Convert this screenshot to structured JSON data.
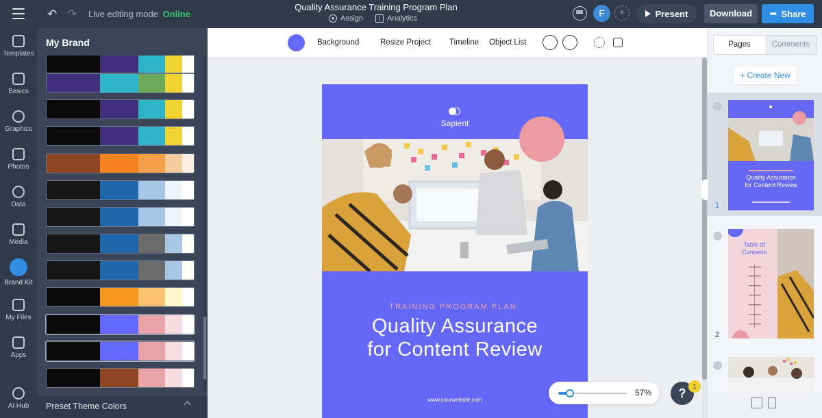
{
  "topbar": {
    "mode_label": "Live editing mode",
    "mode_status": "Online",
    "project_title": "Quality Assurance Training Program Plan",
    "assign_label": "Assign",
    "analytics_label": "Analytics",
    "avatar_letter": "F",
    "present_label": "Present",
    "download_label": "Download",
    "share_label": "Share"
  },
  "rail": {
    "items": [
      {
        "label": "Templates"
      },
      {
        "label": "Basics"
      },
      {
        "label": "Graphics"
      },
      {
        "label": "Photos"
      },
      {
        "label": "Data"
      },
      {
        "label": "Media"
      },
      {
        "label": "Brand Kit"
      },
      {
        "label": "My Files"
      },
      {
        "label": "Apps"
      },
      {
        "label": "AI Hub"
      }
    ]
  },
  "brand_panel": {
    "title": "My Brand",
    "footer_label": "Preset Theme Colors",
    "palettes": [
      [
        "#0b0b0b",
        "#3f2f7c",
        "#2fb5c9",
        "#f0d230",
        "#ffffff"
      ],
      [
        "#3f2f7c",
        "#2fb5c9",
        "#6aaa5a",
        "#f0d230",
        "#ffffff"
      ],
      [
        "#0b0b0b",
        "#3f2f7c",
        "#2fb5c9",
        "#f0d230",
        "#ffffff"
      ],
      [
        "#0b0b0b",
        "#3f2f7c",
        "#2fb5c9",
        "#f0d230",
        "#ffffff"
      ],
      [
        "#8e4522",
        "#f5821f",
        "#f7a04a",
        "#f4cb9d",
        "#fbf0df"
      ],
      [
        "#161616",
        "#1e67ad",
        "#a8c7e6",
        "#eef4fb",
        "#ffffff"
      ],
      [
        "#161616",
        "#1e67ad",
        "#a8c7e6",
        "#eef4fb",
        "#ffffff"
      ],
      [
        "#161616",
        "#1e67ad",
        "#6b6b6b",
        "#a8c7e6",
        "#ffffff"
      ],
      [
        "#161616",
        "#1e67ad",
        "#6b6b6b",
        "#a8c7e6",
        "#ffffff"
      ],
      [
        "#0b0b0b",
        "#f7961e",
        "#fbc36f",
        "#fff6cc",
        "#ffffff"
      ],
      [
        "#0b0b0b",
        "#6468ff",
        "#e8a4a8",
        "#f7dce0",
        "#ffffff"
      ],
      [
        "#0b0b0b",
        "#6468ff",
        "#e8a4a8",
        "#f7dce0",
        "#ffffff"
      ],
      [
        "#0b0b0b",
        "#8e4522",
        "#e8a4a8",
        "#f7dce0",
        "#ffffff"
      ]
    ]
  },
  "canvas_toolbar": {
    "background_label": "Background",
    "resize_label": "Resize Project",
    "timeline_label": "Timeline",
    "object_list_label": "Object List",
    "background_color": "#6468ff"
  },
  "page": {
    "brand_name": "Sapient",
    "kicker": "TRAINING PROGRAM PLAN:",
    "headline_line1": "Quality Assurance",
    "headline_line2": "for Content Review",
    "website": "www.yourwebsite.com",
    "page_color": "#6468f5",
    "accent_color": "#ec9ba3"
  },
  "zoom": {
    "percent_label": "57%",
    "level": 0.57
  },
  "help": {
    "label": "?",
    "badge": "1"
  },
  "pages_panel": {
    "tab_pages": "Pages",
    "tab_comments": "Comments",
    "create_new_label": "+ Create New",
    "page1_number": "1",
    "page2_number": "2",
    "thumb1_title_line1": "Quality Assurance",
    "thumb1_title_line2": "for Content Review",
    "thumb2_title_line1": "Table of",
    "thumb2_title_line2": "Contents"
  }
}
